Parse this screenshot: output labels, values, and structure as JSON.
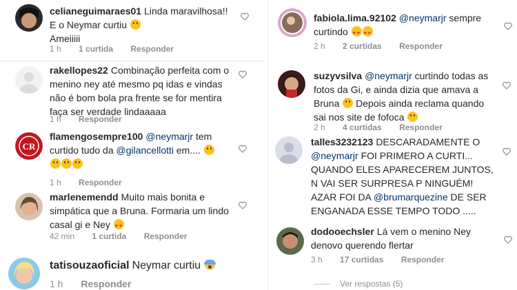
{
  "left": {
    "comments": [
      {
        "username": "celianeguimaraes01",
        "text": "Linda maravilhosa!! E o Neymar curtiu",
        "emojis_after": "wink-emoji",
        "line2": "Ameiiiii",
        "time": "1 h",
        "likes": "1 curtida",
        "reply": "Responder"
      },
      {
        "username": "rakellopes22",
        "text": "Combinação perfeita com o menino ney até mesmo pq idas e vindas não é bom bola pra frente se for mentira faça ser verdade lindaaaaa",
        "time": "1 h",
        "reply": "Responder"
      },
      {
        "username": "flamengosempre100",
        "mention1": "@neymarjr",
        "text1": "tem curtido tudo da",
        "mention2": "@gilancellotti",
        "text2": "em....",
        "emojis_after": "wink-emoji",
        "emojis_line2": "laughing-wink-laughing-emojis",
        "time": "1 h",
        "reply": "Responder"
      },
      {
        "username": "marlenemendd",
        "text": "Muito mais bonita e simpática que a Bruna. Formaria um lindo casal gi e Ney",
        "emojis_after": "heart-eyes-emoji",
        "time": "42 min",
        "likes": "1 curtida",
        "reply": "Responder"
      },
      {
        "username": "tatisouzaoficial",
        "text": "Neymar curtiu",
        "emojis_after": "scream-emoji",
        "time": "1 h",
        "reply": "Responder"
      }
    ]
  },
  "right": {
    "comments": [
      {
        "username": "fabiola.lima.92102",
        "mention": "@neymarjr",
        "text": "sempre curtindo",
        "emojis_after": "heart-eyes-emojis",
        "time": "2 h",
        "likes": "2 curtidas",
        "reply": "Responder"
      },
      {
        "username": "suzyvsilva",
        "mention": "@neymarjr",
        "text": "curtindo todas as fotos da Gi, e ainda dizia que amava a Bruna",
        "text2": "Depois ainda reclama quando sai nos site de fofoca",
        "time": "2 h",
        "likes": "4 curtidas",
        "reply": "Responder"
      },
      {
        "username": "talles3232123",
        "text1": "DESCARADAMENTE O",
        "mention1": "@neymarjr",
        "text2": "FOI PRIMERO A CURTI... QUANDO ELES APARECEREM JUNTOS, N VAI SER SURPRESA P NINGUÉM! AZAR FOI DA",
        "mention2": "@brumarquezine",
        "text3": "DE SER ENGANADA ESSE TEMPO TODO .....",
        "time": "",
        "reply": ""
      },
      {
        "username": "dodooechsler",
        "text": "Lá vem o menino Ney denovo querendo flertar",
        "time": "3 h",
        "likes": "17 curtidas",
        "reply": "Responder"
      }
    ],
    "view_replies": "Ver respostas (5)"
  },
  "colors": {
    "text": "#262626",
    "meta": "#8e8e8e",
    "mention": "#003569",
    "heart": "#8e8e8e"
  }
}
